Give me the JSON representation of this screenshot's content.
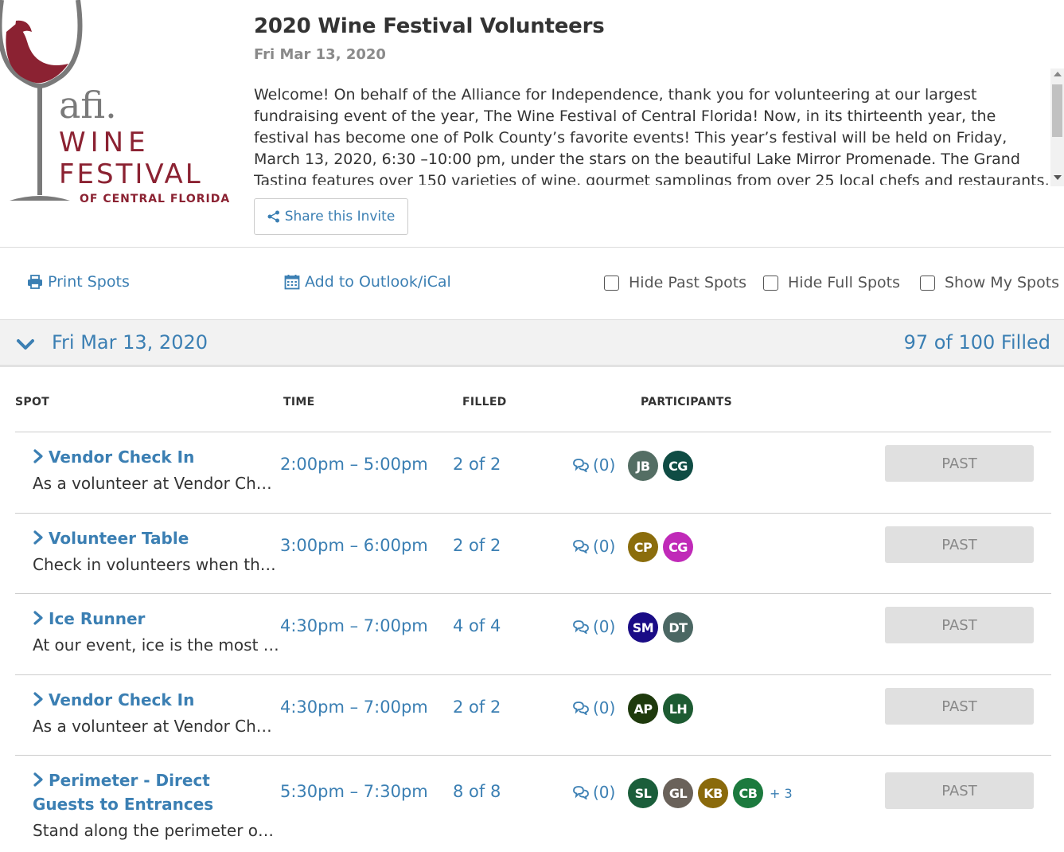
{
  "header": {
    "title": "2020 Wine Festival Volunteers",
    "date": "Fri Mar 13, 2020",
    "description": "Welcome! On behalf of the Alliance for Independence, thank you for volunteering at our largest fundraising event of the year, The Wine Festival of Central Florida! Now, in its thirteenth year, the festival has become one of Polk County’s favorite events! This year’s festival will be held on Friday, March 13, 2020, 6:30 –10:00 pm, under the stars on the beautiful Lake Mirror Promenade. The Grand Tasting features over 150 varieties of wine, gourmet samplings from over 25 local chefs and restaurants, tastings of craft beer and live",
    "share_label": "Share this Invite"
  },
  "logo": {
    "text_afi": "afi.",
    "text_wine": "WINE",
    "text_festival": "FESTIVAL",
    "text_region": "OF CENTRAL FLORIDA",
    "brand_color": "#8b2232"
  },
  "toolbar": {
    "print_label": "Print Spots",
    "calendar_label": "Add to Outlook/iCal",
    "hide_past_label": "Hide Past Spots",
    "hide_full_label": "Hide Full Spots",
    "show_mine_label": "Show My Spots"
  },
  "datebar": {
    "date": "Fri Mar 13, 2020",
    "filled": "97 of 100 Filled"
  },
  "table": {
    "headers": {
      "spot": "SPOT",
      "time": "TIME",
      "filled": "FILLED",
      "participants": "PARTICIPANTS"
    },
    "past_label": "PAST",
    "rows": [
      {
        "name": "Vendor Check In",
        "desc": "As a volunteer at Vendor Ch…",
        "time": "2:00pm – 5:00pm",
        "filled": "2 of 2",
        "comments": "(0)",
        "participants": [
          {
            "initials": "JB",
            "color": "#546e64"
          },
          {
            "initials": "CG",
            "color": "#0f4c44"
          }
        ],
        "more": ""
      },
      {
        "name": "Volunteer Table",
        "desc": "Check in volunteers when th…",
        "time": "3:00pm – 6:00pm",
        "filled": "2 of 2",
        "comments": "(0)",
        "participants": [
          {
            "initials": "CP",
            "color": "#8b6d0c"
          },
          {
            "initials": "CG",
            "color": "#c02ab8"
          }
        ],
        "more": ""
      },
      {
        "name": "Ice Runner",
        "desc": "At our event, ice is the most …",
        "time": "4:30pm – 7:00pm",
        "filled": "4 of 4",
        "comments": "(0)",
        "participants": [
          {
            "initials": "SM",
            "color": "#1a0c86"
          },
          {
            "initials": "DT",
            "color": "#4b6763"
          }
        ],
        "more": ""
      },
      {
        "name": "Vendor Check In",
        "desc": "As a volunteer at Vendor Ch…",
        "time": "4:30pm – 7:00pm",
        "filled": "2 of 2",
        "comments": "(0)",
        "participants": [
          {
            "initials": "AP",
            "color": "#1f3a0d"
          },
          {
            "initials": "LH",
            "color": "#1d5b32"
          }
        ],
        "more": ""
      },
      {
        "name": "Perimeter - Direct Guests to Entrances",
        "desc": "Stand along the perimeter o…",
        "time": "5:30pm – 7:30pm",
        "filled": "8 of 8",
        "comments": "(0)",
        "participants": [
          {
            "initials": "SL",
            "color": "#1b5e3b"
          },
          {
            "initials": "GL",
            "color": "#6a625a"
          },
          {
            "initials": "KB",
            "color": "#8a6a0c"
          },
          {
            "initials": "CB",
            "color": "#1c7a3e"
          }
        ],
        "more": "+ 3"
      }
    ]
  }
}
